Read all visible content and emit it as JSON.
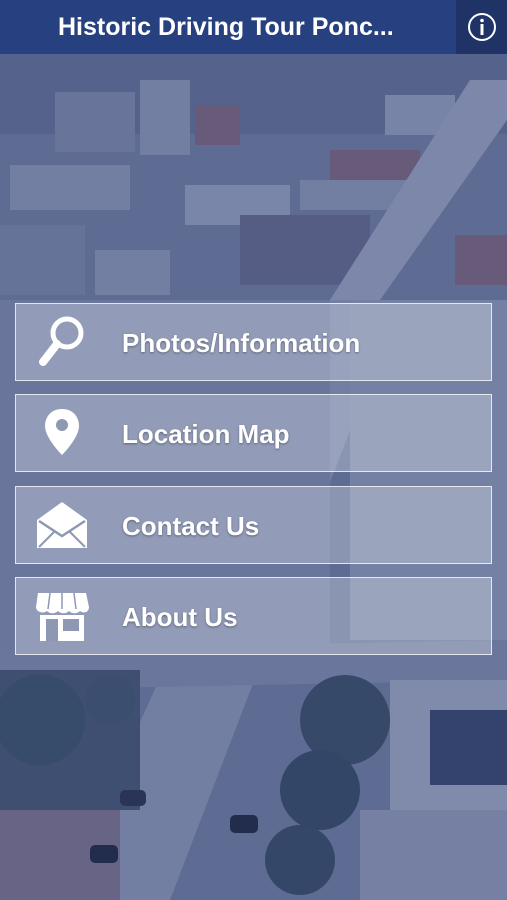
{
  "header": {
    "title": "Historic Driving Tour Ponc...",
    "info_icon": "info-circle-icon"
  },
  "menu": [
    {
      "label": "Photos/Information",
      "icon": "search-icon"
    },
    {
      "label": "Location Map",
      "icon": "map-pin-icon"
    },
    {
      "label": "Contact Us",
      "icon": "envelope-icon"
    },
    {
      "label": "About Us",
      "icon": "storefront-icon"
    }
  ],
  "colors": {
    "header_bg": "#27407f",
    "info_bg": "#203366",
    "overlay_tint": "#28407a",
    "text": "#ffffff"
  }
}
